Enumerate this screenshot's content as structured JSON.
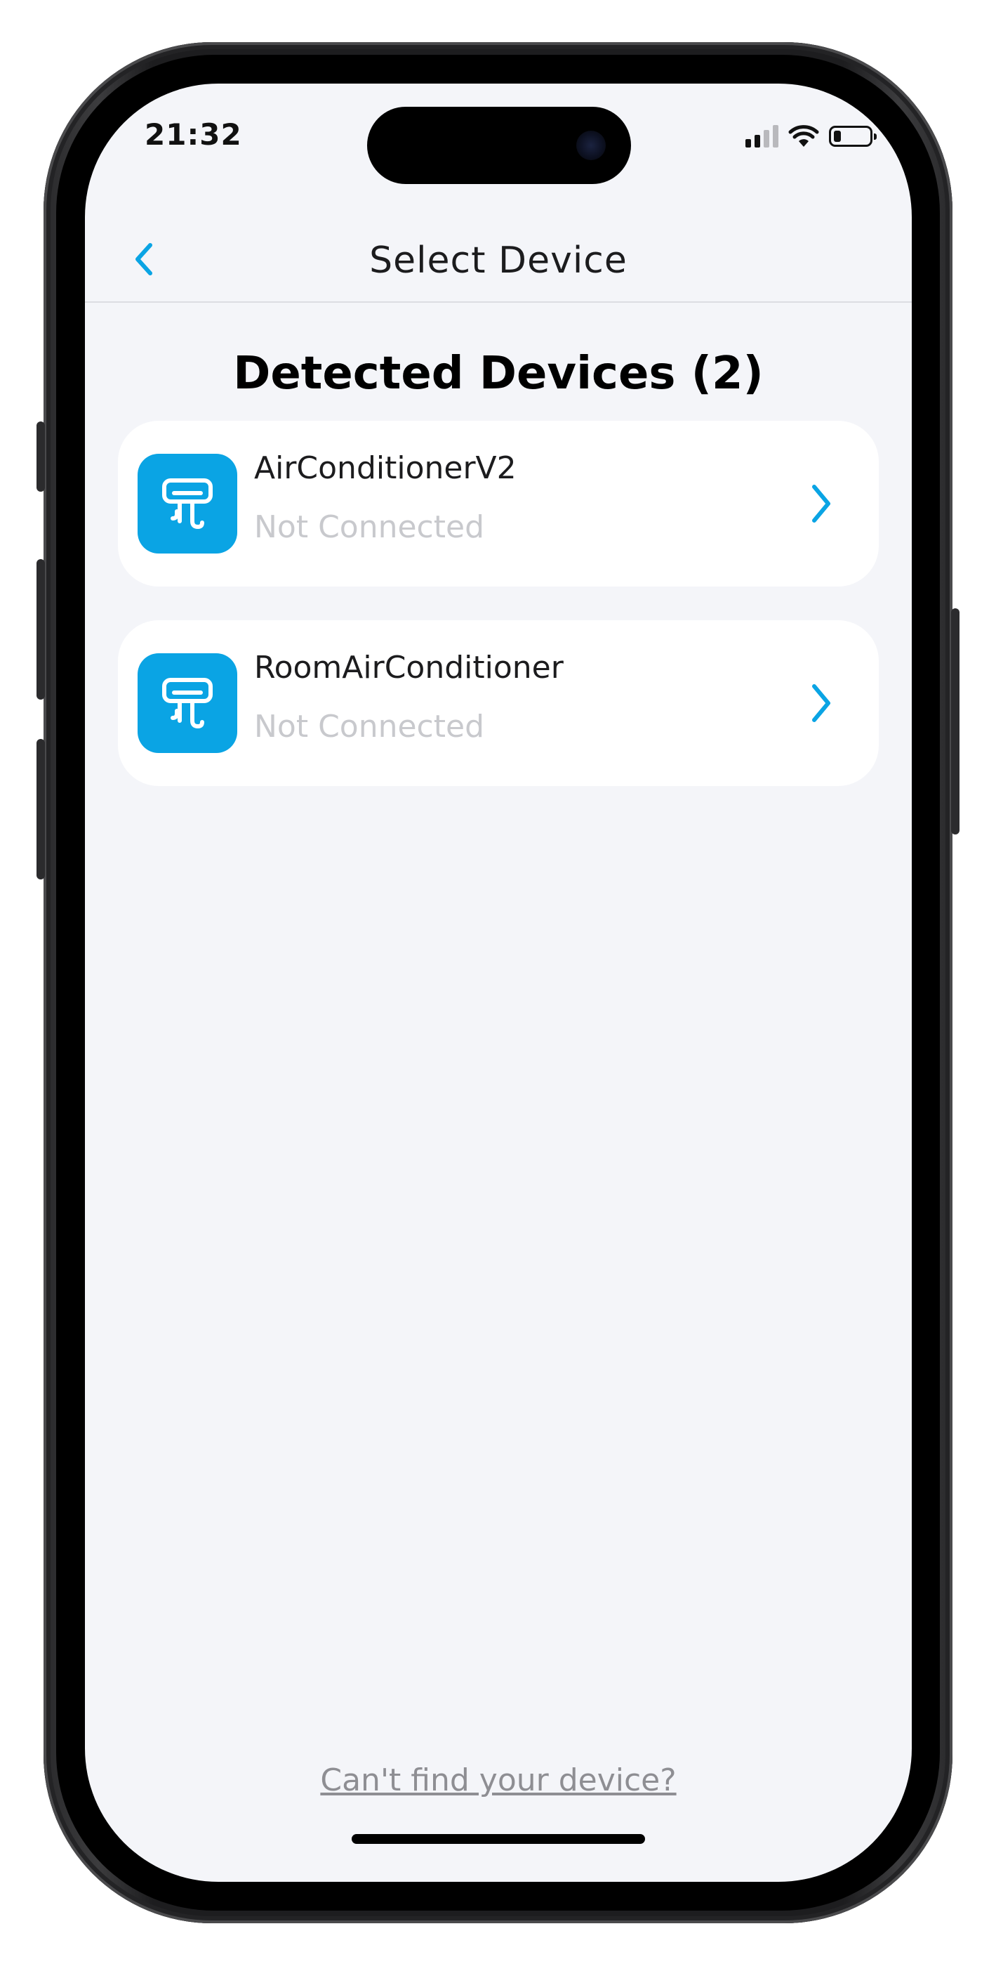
{
  "status_bar": {
    "time": "21:32",
    "battery_level": 0.2
  },
  "nav": {
    "back_icon": "chevron-left-icon",
    "title": "Select Device"
  },
  "section": {
    "title": "Detected Devices (2)"
  },
  "devices": [
    {
      "name": "AirConditionerV2",
      "status": "Not Connected",
      "icon": "air-conditioner-icon"
    },
    {
      "name": "RoomAirConditioner",
      "status": "Not Connected",
      "icon": "air-conditioner-icon"
    }
  ],
  "footer": {
    "help_link": "Can't find your device?"
  },
  "colors": {
    "accent": "#0aa4e4",
    "background": "#f4f5f9",
    "card": "#ffffff",
    "muted_text": "#c8c9cd",
    "link_text": "#8e8e93"
  }
}
